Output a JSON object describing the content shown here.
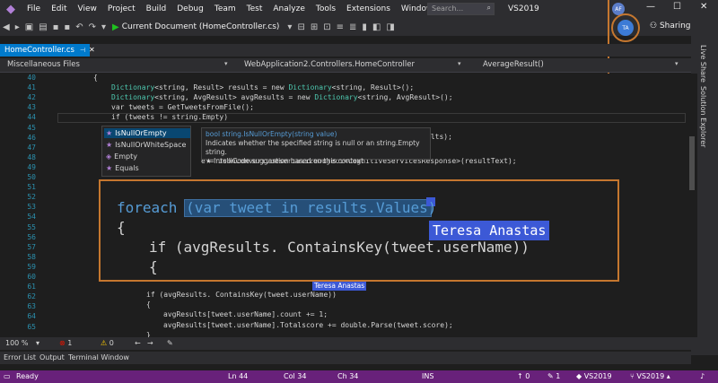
{
  "titlebar": {
    "menu": [
      "File",
      "Edit",
      "View",
      "Project",
      "Build",
      "Debug",
      "Team",
      "Test",
      "Analyze",
      "Tools",
      "Extensions",
      "Window",
      "Help"
    ],
    "search_placeholder": "Search...",
    "app_title": "VS2019",
    "user_initials": "AF"
  },
  "toolbar": {
    "run_label": "Current Document (HomeController.cs)",
    "collab_initials": "TA",
    "sharing_label": "Sharing"
  },
  "tabs": {
    "active_tab": "HomeController.cs"
  },
  "navbar": {
    "project": "Miscellaneous Files",
    "type": "WebApplication2.Controllers.HomeController",
    "member": "AverageResult()"
  },
  "sidebar": {
    "live_share": "Live Share",
    "solution_explorer": "Solution Explorer"
  },
  "editor": {
    "line_numbers": [
      "40",
      "41",
      "42",
      "43",
      "44",
      "45",
      "46",
      "47",
      "48",
      "49",
      "50",
      "51",
      "52",
      "53",
      "54",
      "55",
      "56",
      "57",
      "58",
      "59",
      "60",
      "61",
      "62",
      "63",
      "64",
      "65"
    ],
    "code": {
      "l40": "{",
      "l41a": "Dictionary",
      "l41b": "<string, Result> results = new ",
      "l41c": "Dictionary",
      "l41d": "<string, Result>();",
      "l42a": "Dictionary",
      "l42b": "<string, AvgResult> avgResults = new ",
      "l42c": "Dictionary",
      "l42d": "<string, AvgResult>();",
      "l43": "var tweets = GetTweetsFromFile();",
      "l44": "if (tweets != string.Empty)",
      "l46_tail": "ults);",
      "l48_tail": "e = JsonConvert.DeserializeObject<CognitiveServicesResponse>(resultText);",
      "l61": "if (avgResults. ContainsKey(tweet.userName))",
      "l62": "{",
      "l63": "avgResults[tweet.userName].count += 1;",
      "l64": "avgResults[tweet.userName].Totalscore += double.Parse(tweet.score);",
      "l65": "}"
    }
  },
  "completion": {
    "items": [
      "IsNullOrEmpty",
      "IsNullOrWhiteSpace",
      "Empty",
      "Equals"
    ],
    "selected": "IsNullOrEmpty"
  },
  "tooltip": {
    "signature": "bool string.IsNullOrEmpty(string value)",
    "description": "Indicates whether the specified string is null or an string.Empty string.",
    "suggestion": "IntelliCode suggestion based on this context"
  },
  "zoom": {
    "line1": "foreach (var tweet in results.Values)",
    "line2": "{",
    "line3": "if (avgResults. ContainsKey(tweet.userName))",
    "line4": "{",
    "collaborator": "Teresa Anastas"
  },
  "small_flag": "Teresa Anastas",
  "editor_status": {
    "zoom": "100 %",
    "errors": "1",
    "warnings": "0"
  },
  "tool_tabs": [
    "Error List",
    "Output",
    "Terminal Window"
  ],
  "statusbar": {
    "ready": "Ready",
    "ln": "Ln 44",
    "col": "Col 34",
    "ch": "Ch 34",
    "ins": "INS",
    "up": "0",
    "pencil": "1",
    "repo": "VS2019",
    "branch": "VS2019"
  },
  "colors": {
    "accent": "#007acc",
    "status": "#68217a",
    "highlight": "#c5772f",
    "collab": "#3c59d6"
  }
}
